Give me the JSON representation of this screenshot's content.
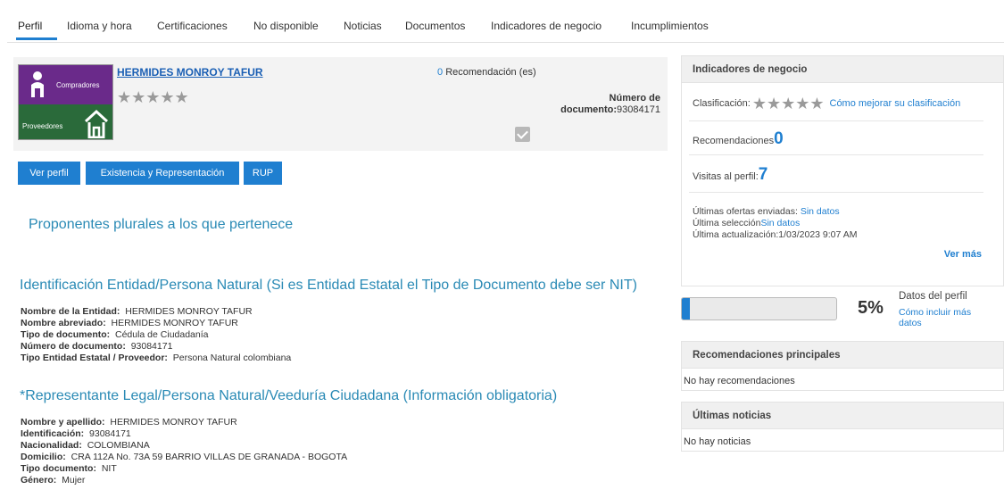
{
  "tabs": [
    {
      "label": "Perfil"
    },
    {
      "label": "Idioma y hora"
    },
    {
      "label": "Certificaciones"
    },
    {
      "label": "No disponible"
    },
    {
      "label": "Noticias"
    },
    {
      "label": "Documentos"
    },
    {
      "label": "Indicadores de negocio"
    },
    {
      "label": "Incumplimientos"
    }
  ],
  "profile": {
    "logo_top_text": "Compradores",
    "logo_bottom_text": "Proveedores",
    "name": "HERMIDES MONROY TAFUR",
    "recommendations_count": "0",
    "recommendations_label": "Recomendación (es)",
    "doc_label": "Número de documento:",
    "doc_label_line1": "Número de",
    "doc_label_line2": "documento:",
    "doc_number": "93084171",
    "stars": "★★★★★"
  },
  "buttons": {
    "ver_perfil": "Ver perfil",
    "existencia": "Existencia y Representación",
    "rup": "RUP"
  },
  "sections": {
    "proponentes": "Proponentes plurales a los que pertenece",
    "identificacion": "Identificación Entidad/Persona Natural (Si es Entidad Estatal el Tipo de Documento debe ser NIT)",
    "representante": "*Representante Legal/Persona Natural/Veeduría Ciudadana (Información obligatoria)"
  },
  "identificacion": [
    {
      "k": "Nombre de la Entidad:",
      "v": "HERMIDES MONROY TAFUR"
    },
    {
      "k": "Nombre abreviado:",
      "v": "HERMIDES MONROY TAFUR"
    },
    {
      "k": "Tipo de documento:",
      "v": "Cédula de Ciudadanía"
    },
    {
      "k": "Número de documento:",
      "v": "93084171"
    },
    {
      "k": "Tipo Entidad Estatal / Proveedor:",
      "v": "Persona Natural colombiana"
    }
  ],
  "representante": [
    {
      "k": "Nombre y apellido:",
      "v": "HERMIDES MONROY TAFUR"
    },
    {
      "k": "Identificación:",
      "v": "93084171"
    },
    {
      "k": "Nacionalidad:",
      "v": "COLOMBIANA"
    },
    {
      "k": "Domicilio:",
      "v": "CRA 112A No. 73A 59 BARRIO VILLAS DE GRANADA - BOGOTA"
    },
    {
      "k": "Tipo documento:",
      "v": "NIT"
    },
    {
      "k": "Género:",
      "v": "Mujer"
    }
  ],
  "indicadores": {
    "title": "Indicadores de negocio",
    "clasificacion_label": "Clasificación:",
    "mejorar_link": "Cómo mejorar su clasificación",
    "recomendaciones_label": "Recomendaciones",
    "recomendaciones_value": "0",
    "visitas_label": "Visitas al perfil:",
    "visitas_value": "7",
    "ofertas_label": "Últimas ofertas enviadas:",
    "ofertas_value": "Sin datos",
    "seleccion_label": "Última selección",
    "seleccion_value": "Sin datos",
    "actualizacion_label": "Última actualización:",
    "actualizacion_value": "1/03/2023 9:07 AM",
    "ver_mas": "Ver más"
  },
  "perfil_progress": {
    "percent_text": "5%",
    "percent": 5,
    "label": "Datos del perfil",
    "link": "Cómo incluir más datos"
  },
  "recomendaciones_principales": {
    "title": "Recomendaciones principales",
    "body": "No hay recomendaciones"
  },
  "ultimas_noticias": {
    "title": "Últimas noticias",
    "body": "No hay noticias"
  },
  "colors": {
    "accent": "#1f7fd0",
    "section_heading": "#2a8ab5",
    "logo_purple": "#6a2a8a",
    "logo_green": "#2a6a3a"
  }
}
